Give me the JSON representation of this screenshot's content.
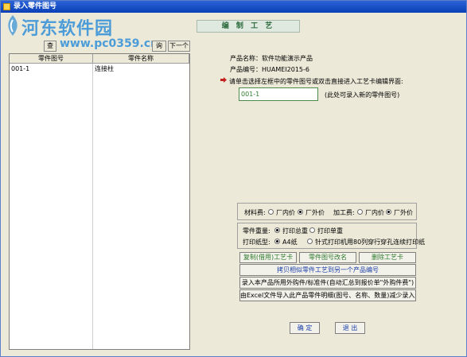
{
  "window": {
    "title": "录入零件图号"
  },
  "watermark": {
    "line1": "河东软件园",
    "line2": "www.pc0359.cn"
  },
  "banner": {
    "title": "编 制 工 艺"
  },
  "toolbar": {
    "find_label": "查",
    "mid_label": "询",
    "next_label": "下一个"
  },
  "list": {
    "columns": [
      "零件图号",
      "零件名称"
    ],
    "rows": [
      {
        "part_no": "001-1",
        "part_name": "连接柱"
      }
    ]
  },
  "product": {
    "name_label": "产品名称：",
    "name_value": "软件功能演示产品",
    "code_label": "产品编号：",
    "code_value": "HUAMEI2015-6"
  },
  "instruction": "请单击选择左框中的零件图号或双击直接进入工艺卡编辑界面:",
  "part_input": {
    "value": "001-1",
    "hint": "(此处可录入新的零件图号)"
  },
  "options": {
    "material_label": "材料费:",
    "material_opts": [
      "厂内价",
      "厂外价"
    ],
    "process_label": "加工费:",
    "process_opts": [
      "厂内价",
      "厂外价"
    ],
    "weight_label": "零件重量:",
    "weight_opts": [
      "打印总重",
      "打印单重"
    ],
    "paper_label": "打印纸型:",
    "paper_opts": [
      "A4纸",
      "针式打印机用80列穿行穿孔连续打印纸"
    ]
  },
  "buttons": {
    "copy_card": "复制(借用)工艺卡",
    "rename": "零件图号改名",
    "delete_card": "删除工艺卡",
    "copy_all": "拷贝相似零件工艺到另一个产品编号",
    "import_outsource": "录入本产品所用外购件/标准件(自动汇总到报价单\"外购件费\")",
    "import_excel": "由Excel文件导入此产品零件明细(图号、名称、数量)减少录入量",
    "ok": "确 定",
    "exit": "退 出"
  }
}
